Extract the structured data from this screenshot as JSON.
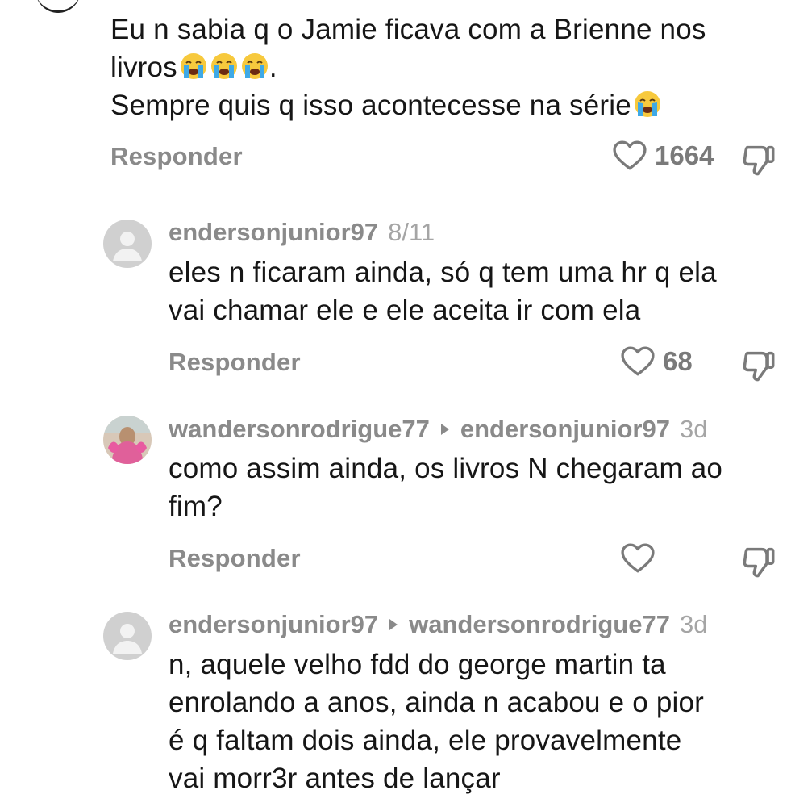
{
  "top_comment": {
    "line1": "Eu n sabia q o Jamie ficava com a Brienne nos",
    "line2_text": "livros",
    "line2_end": ".",
    "line3_text": "Sempre quis q isso acontecesse na série",
    "reply_label": "Responder",
    "likes": "1664",
    "emoji_icon": "loudly-crying-face"
  },
  "replies": [
    {
      "username": "endersonjunior97",
      "reply_to": "",
      "date": "8/11",
      "lines": [
        "eles n ficaram ainda, só q tem uma hr q ela",
        "vai chamar ele e ele aceita ir com ela"
      ],
      "reply_label": "Responder",
      "likes": "68"
    },
    {
      "username": "wandersonrodrigue77",
      "reply_to": "endersonjunior97",
      "date": "3d",
      "lines": [
        "como assim ainda, os livros N chegaram ao",
        "fim?"
      ],
      "reply_label": "Responder",
      "likes": ""
    },
    {
      "username": "endersonjunior97",
      "reply_to": "wandersonrodrigue77",
      "date": "3d",
      "lines": [
        "n, aquele velho fdd do george martin ta",
        "enrolando a anos, ainda n acabou e o pior",
        "é q faltam dois ainda, ele provavelmente",
        "vai morr3r antes de lançar"
      ],
      "reply_label": "Responder",
      "likes": ""
    }
  ],
  "colors": {
    "muted_text": "#8a8a8a",
    "body_text": "#161616",
    "icon": "#7a7a7a",
    "default_avatar_bg": "#d0d0d0",
    "emoji_face": "#f7c93d",
    "emoji_tears": "#3fa9e6"
  }
}
